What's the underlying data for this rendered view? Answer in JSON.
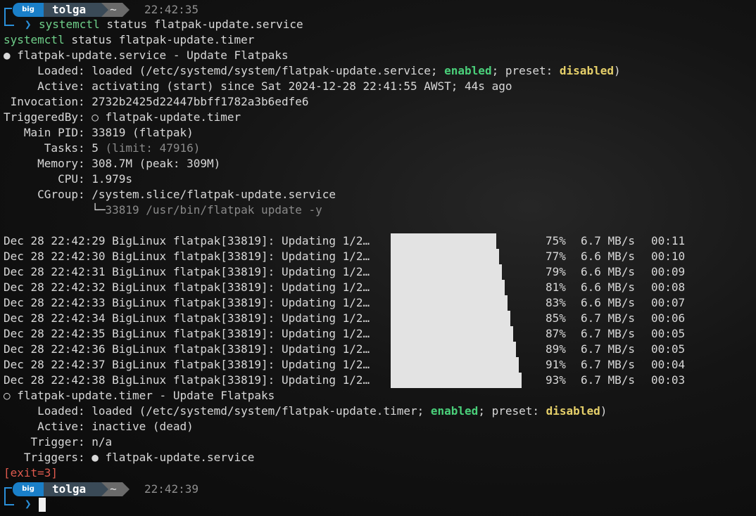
{
  "prompt": {
    "logo": "big",
    "user": "tolga",
    "dir": "~",
    "time1": "22:42:35",
    "time2": "22:42:39",
    "chevron": "❯"
  },
  "cmd1": "systemctl",
  "cmd1_rest": " status flatpak-update.service",
  "cmd2": "systemctl",
  "cmd2_rest": " status flatpak-update.timer",
  "service": {
    "header": "● flatpak-update.service - Update Flatpaks",
    "loaded_pre": "     Loaded: loaded (/etc/systemd/system/flatpak-update.service; ",
    "enabled": "enabled",
    "mid": "; preset: ",
    "disabled": "disabled",
    "post": ")",
    "active": "     Active: activating (start) since Sat 2024-12-28 22:41:55 AWST; 44s ago",
    "invocation": " Invocation: 2732b2425d22447bbff1782a3b6edfe6",
    "triggered": "TriggeredBy: ○ flatpak-update.timer",
    "pid": "   Main PID: 33819 (flatpak)",
    "tasks_pre": "      Tasks: 5 ",
    "tasks_dim": "(limit: 47916)",
    "memory": "     Memory: 308.7M (peak: 309M)",
    "cpu": "        CPU: 1.979s",
    "cgroup": "     CGroup: /system.slice/flatpak-update.service",
    "cgroup_tree": "             └─",
    "cgroup_proc": "33819 /usr/bin/flatpak update -y"
  },
  "logs": [
    {
      "text": "Dec 28 22:42:29 BigLinux flatpak[33819]: Updating 1/2…",
      "progress": 75,
      "pct": "75%",
      "speed": "6.7 MB/s",
      "eta": "00:11"
    },
    {
      "text": "Dec 28 22:42:30 BigLinux flatpak[33819]: Updating 1/2…",
      "progress": 77,
      "pct": "77%",
      "speed": "6.6 MB/s",
      "eta": "00:10"
    },
    {
      "text": "Dec 28 22:42:31 BigLinux flatpak[33819]: Updating 1/2…",
      "progress": 79,
      "pct": "79%",
      "speed": "6.6 MB/s",
      "eta": "00:09"
    },
    {
      "text": "Dec 28 22:42:32 BigLinux flatpak[33819]: Updating 1/2…",
      "progress": 81,
      "pct": "81%",
      "speed": "6.6 MB/s",
      "eta": "00:08"
    },
    {
      "text": "Dec 28 22:42:33 BigLinux flatpak[33819]: Updating 1/2…",
      "progress": 83,
      "pct": "83%",
      "speed": "6.6 MB/s",
      "eta": "00:07"
    },
    {
      "text": "Dec 28 22:42:34 BigLinux flatpak[33819]: Updating 1/2…",
      "progress": 85,
      "pct": "85%",
      "speed": "6.7 MB/s",
      "eta": "00:06"
    },
    {
      "text": "Dec 28 22:42:35 BigLinux flatpak[33819]: Updating 1/2…",
      "progress": 87,
      "pct": "87%",
      "speed": "6.7 MB/s",
      "eta": "00:05"
    },
    {
      "text": "Dec 28 22:42:36 BigLinux flatpak[33819]: Updating 1/2…",
      "progress": 89,
      "pct": "89%",
      "speed": "6.7 MB/s",
      "eta": "00:05"
    },
    {
      "text": "Dec 28 22:42:37 BigLinux flatpak[33819]: Updating 1/2…",
      "progress": 91,
      "pct": "91%",
      "speed": "6.7 MB/s",
      "eta": "00:04"
    },
    {
      "text": "Dec 28 22:42:38 BigLinux flatpak[33819]: Updating 1/2…",
      "progress": 93,
      "pct": "93%",
      "speed": "6.7 MB/s",
      "eta": "00:03"
    }
  ],
  "timer": {
    "header": "○ flatpak-update.timer - Update Flatpaks",
    "loaded_pre": "     Loaded: loaded (/etc/systemd/system/flatpak-update.timer; ",
    "enabled": "enabled",
    "mid": "; preset: ",
    "disabled": "disabled",
    "post": ")",
    "active": "     Active: inactive (dead)",
    "trigger": "    Trigger: n/a",
    "triggers": "   Triggers: ● flatpak-update.service"
  },
  "exit": "[exit=3]"
}
